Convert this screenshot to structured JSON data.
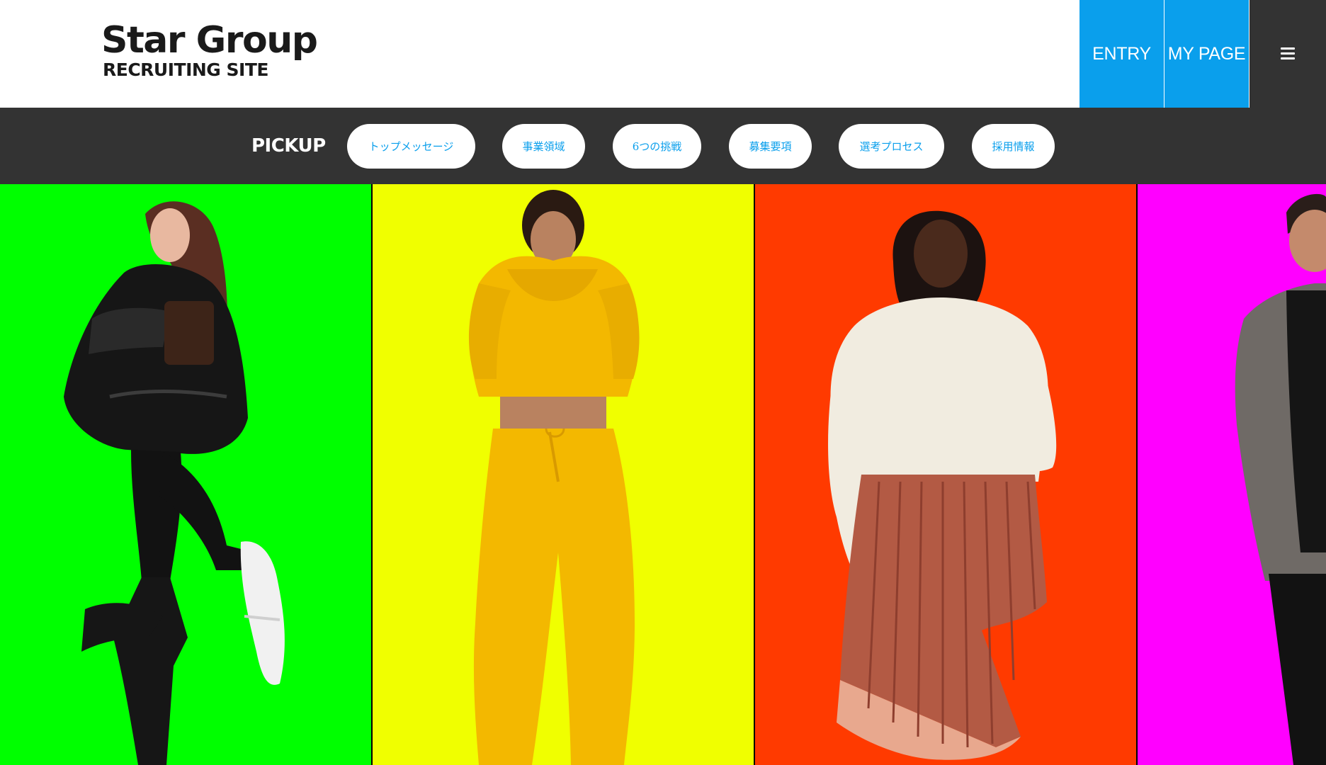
{
  "header": {
    "logo": {
      "title": "Star Group",
      "subtitle": "RECRUITING SITE"
    },
    "entry_label": "ENTRY",
    "mypage_label": "MY PAGE",
    "menu_icon": "hamburger-menu-icon"
  },
  "pickup": {
    "label": "PICKUP",
    "items": [
      {
        "label": "トップメッセージ"
      },
      {
        "label": "事業領域"
      },
      {
        "label": "6つの挑戦"
      },
      {
        "label": "募集要項"
      },
      {
        "label": "選考プロセス"
      },
      {
        "label": "採用情報"
      }
    ]
  },
  "colors": {
    "accent_blue": "#0a9fec",
    "dark_bar": "#333333",
    "panel_green": "#00ff00",
    "panel_yellow": "#f0ff00",
    "panel_orange": "#ff3a00",
    "panel_magenta": "#ff00ff"
  }
}
